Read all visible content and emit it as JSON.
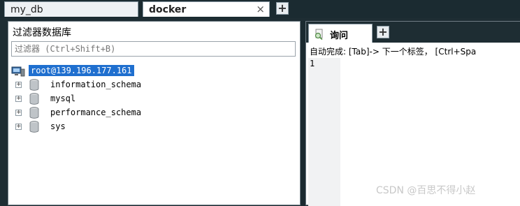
{
  "connection_tabs": [
    {
      "label": "my_db",
      "active": false
    },
    {
      "label": "docker",
      "active": true
    }
  ],
  "close_glyph": "×",
  "add_glyph": "+",
  "object_browser": {
    "title": "过滤器数据库",
    "filter_placeholder": "过滤器 (Ctrl+Shift+B)",
    "root": {
      "label": "root@139.196.177.161",
      "icon": "server-icon"
    },
    "databases": [
      {
        "name": "information_schema",
        "icon": "database-icon"
      },
      {
        "name": "mysql",
        "icon": "database-icon"
      },
      {
        "name": "performance_schema",
        "icon": "database-icon"
      },
      {
        "name": "sys",
        "icon": "database-icon"
      }
    ],
    "expander_glyph": "+"
  },
  "query_panel": {
    "tab_label": "询问",
    "autocomplete_hint": "自动完成: [Tab]-> 下一个标签， [Ctrl+Spa",
    "line_numbers": [
      "1"
    ]
  },
  "watermark": "CSDN @百思不得小赵",
  "colors": {
    "background": "#1e2d33",
    "selection": "#1f6fcf"
  }
}
